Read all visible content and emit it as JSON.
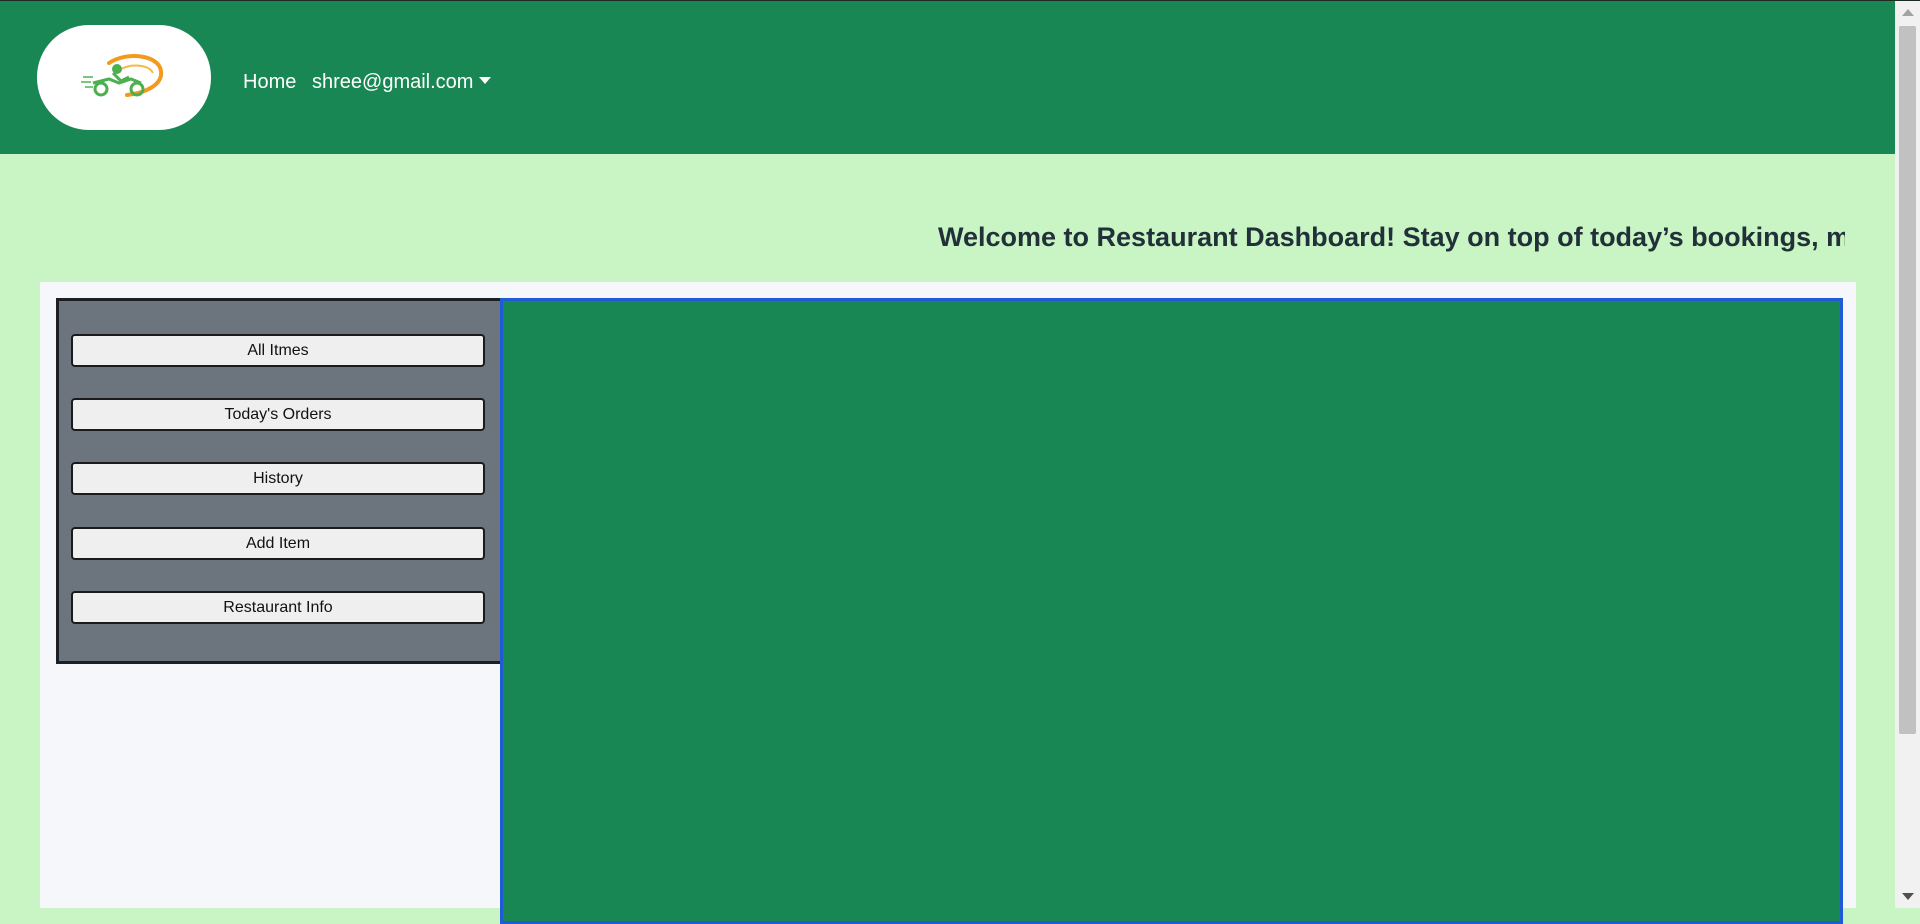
{
  "navbar": {
    "bg_color": "#198754",
    "logo_icon": "delivery-scooter-logo-icon",
    "home_label": "Home",
    "user_menu_label": "shree@gmail.com"
  },
  "welcome": {
    "message": "Welcome to Restaurant Dashboard! Stay on top of today’s bookings, ma"
  },
  "sidebar": {
    "bg_color": "#6c757d",
    "items": [
      {
        "label": "All Itmes"
      },
      {
        "label": "Today's Orders"
      },
      {
        "label": "History"
      },
      {
        "label": "Add Item"
      },
      {
        "label": "Restaurant Info"
      }
    ]
  },
  "main_panel": {
    "bg_color": "#198754",
    "border_color": "#1f5bd6"
  },
  "page_bg_color": "#c8f5c3"
}
